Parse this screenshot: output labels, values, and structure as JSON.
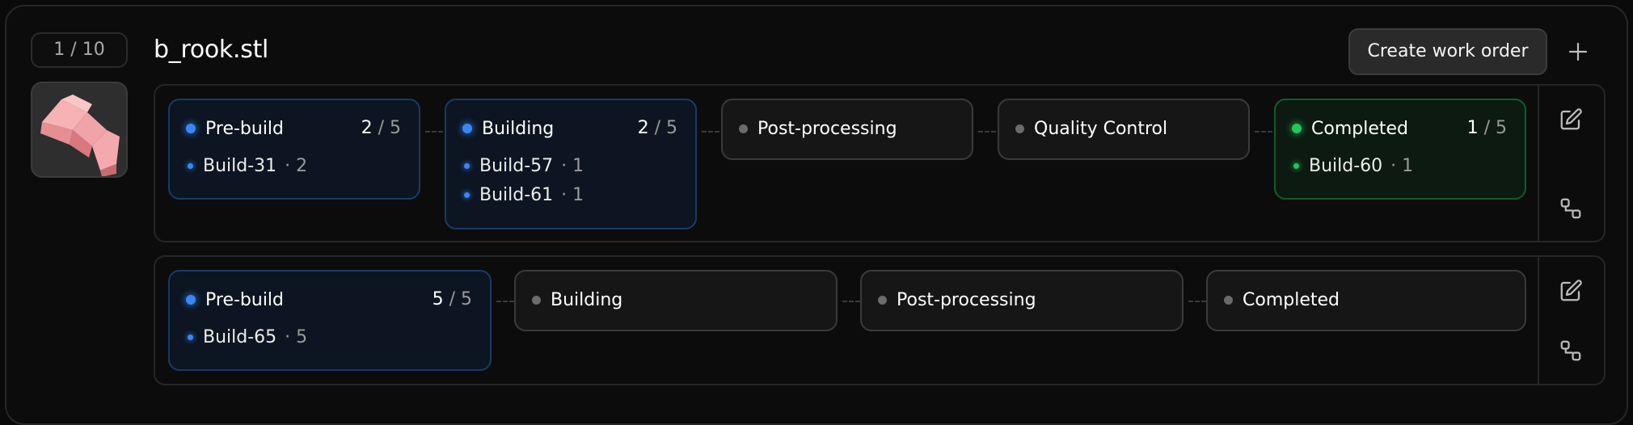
{
  "item": {
    "counter": "1 / 10",
    "filename": "b_rook.stl",
    "thumbnail_icon": "rook-model-icon"
  },
  "toolbar": {
    "create_work_order_label": "Create work order",
    "add_icon": "plus-icon"
  },
  "workflows": [
    {
      "stages": [
        {
          "name": "Pre-build",
          "status": "active",
          "done": "2",
          "total": "5",
          "count_sep": " / ",
          "builds": [
            {
              "label": "Build-31",
              "qty": "· 2"
            }
          ]
        },
        {
          "name": "Building",
          "status": "active",
          "done": "2",
          "total": "5",
          "count_sep": " / ",
          "builds": [
            {
              "label": "Build-57",
              "qty": "· 1"
            },
            {
              "label": "Build-61",
              "qty": "· 1"
            }
          ]
        },
        {
          "name": "Post-processing",
          "status": "idle"
        },
        {
          "name": "Quality Control",
          "status": "idle"
        },
        {
          "name": "Completed",
          "status": "complete",
          "done": "1",
          "total": "5",
          "count_sep": " / ",
          "builds": [
            {
              "label": "Build-60",
              "qty": "· 1"
            }
          ]
        }
      ],
      "actions": [
        "edit-icon",
        "workflow-icon"
      ]
    },
    {
      "stages": [
        {
          "name": "Pre-build",
          "status": "active",
          "done": "5",
          "total": "5",
          "count_sep": " / ",
          "builds": [
            {
              "label": "Build-65",
              "qty": "· 5"
            }
          ]
        },
        {
          "name": "Building",
          "status": "idle"
        },
        {
          "name": "Post-processing",
          "status": "idle"
        },
        {
          "name": "Completed",
          "status": "idle"
        }
      ],
      "actions": [
        "edit-icon",
        "workflow-icon"
      ]
    }
  ],
  "colors": {
    "active": "#3b86f7",
    "complete": "#22c55e",
    "idle": "#6b6b6b"
  }
}
